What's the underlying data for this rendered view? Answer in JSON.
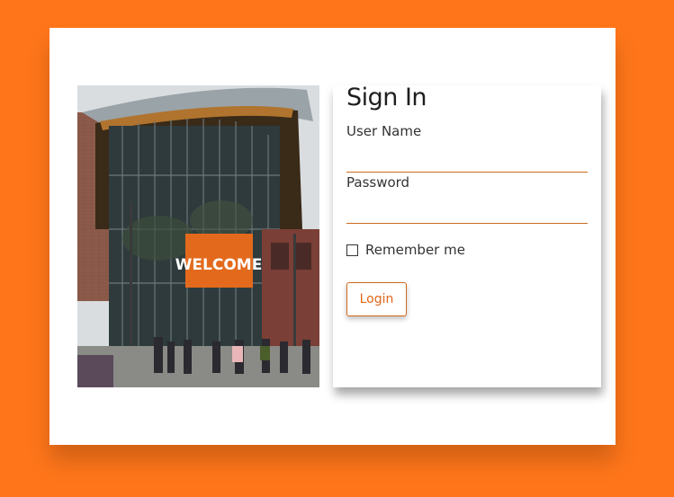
{
  "signin": {
    "title": "Sign In",
    "username_label": "User Name",
    "username_value": "",
    "password_label": "Password",
    "password_value": "",
    "remember_label": "Remember me",
    "remember_checked": false,
    "login_label": "Login"
  },
  "photo": {
    "banner_text": "WELCOME",
    "description": "campus-building-photo"
  },
  "colors": {
    "background": "#ff761a",
    "accent": "#e0661a",
    "card": "#ffffff"
  }
}
